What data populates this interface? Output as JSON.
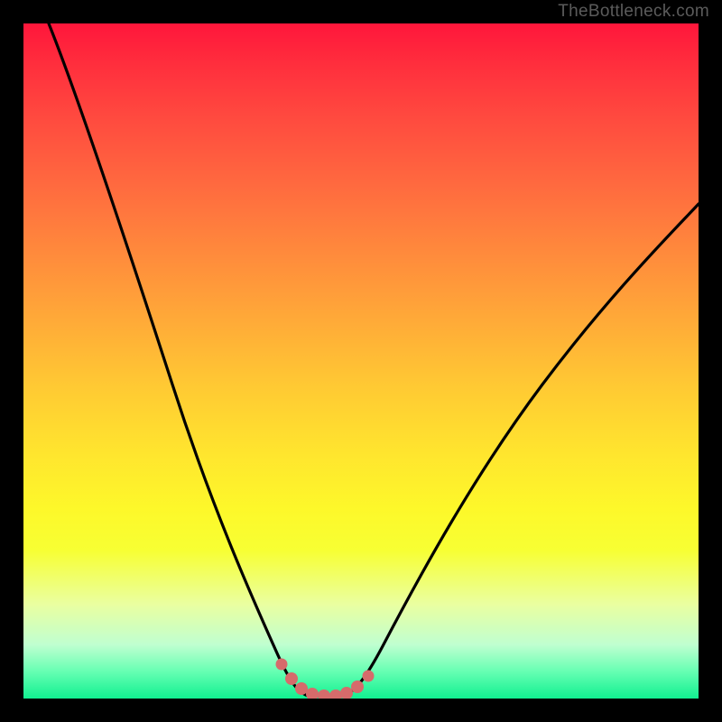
{
  "watermark": {
    "text": "TheBottleneck.com"
  },
  "chart_data": {
    "type": "line",
    "title": "",
    "xlabel": "",
    "ylabel": "",
    "xlim": [
      0,
      100
    ],
    "ylim": [
      0,
      100
    ],
    "grid": false,
    "series": [
      {
        "name": "bottleneck-curve",
        "note": "V-shaped curve; y≈100 at left edge, dips to ≈0 near x≈42–48, rises to ≈62 at right edge",
        "x": [
          4,
          8,
          12,
          16,
          20,
          24,
          28,
          32,
          36,
          38,
          40,
          42,
          44,
          46,
          48,
          50,
          52,
          56,
          60,
          66,
          72,
          80,
          88,
          96,
          100
        ],
        "y": [
          100,
          90,
          79,
          68,
          57,
          46,
          36,
          26,
          16,
          11,
          7,
          3,
          1,
          0,
          0,
          1,
          3,
          8,
          14,
          22,
          30,
          40,
          49,
          58,
          62
        ]
      },
      {
        "name": "trough-markers",
        "note": "small rounded salmon dots along trough region",
        "x": [
          38.5,
          40.5,
          42,
          43.5,
          45,
          46.5,
          48,
          49.5,
          51
        ],
        "y": [
          4.2,
          2.0,
          0.9,
          0.4,
          0.2,
          0.2,
          0.4,
          1.0,
          2.2
        ]
      }
    ],
    "colors": {
      "curve": "#000000",
      "markers": "#d66b6b",
      "gradient_top": "#ff163b",
      "gradient_bottom": "#11f090",
      "page_bg": "#000000"
    }
  }
}
